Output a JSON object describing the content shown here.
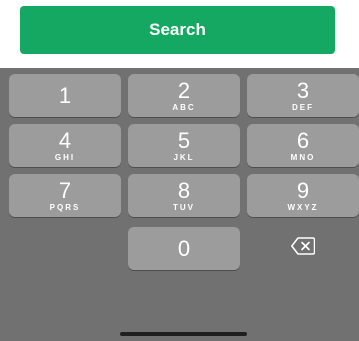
{
  "search": {
    "label": "Search"
  },
  "colors": {
    "accent": "#14a862",
    "keyboard_bg": "#717171",
    "key_bg": "#9c9c9c",
    "key_text": "#ffffff"
  },
  "keypad": {
    "keys": [
      {
        "digit": "1",
        "letters": ""
      },
      {
        "digit": "2",
        "letters": "ABC"
      },
      {
        "digit": "3",
        "letters": "DEF"
      },
      {
        "digit": "4",
        "letters": "GHI"
      },
      {
        "digit": "5",
        "letters": "JKL"
      },
      {
        "digit": "6",
        "letters": "MNO"
      },
      {
        "digit": "7",
        "letters": "PQRS"
      },
      {
        "digit": "8",
        "letters": "TUV"
      },
      {
        "digit": "9",
        "letters": "WXYZ"
      },
      {
        "digit": "0",
        "letters": ""
      }
    ],
    "backspace_icon": "backspace-icon"
  }
}
